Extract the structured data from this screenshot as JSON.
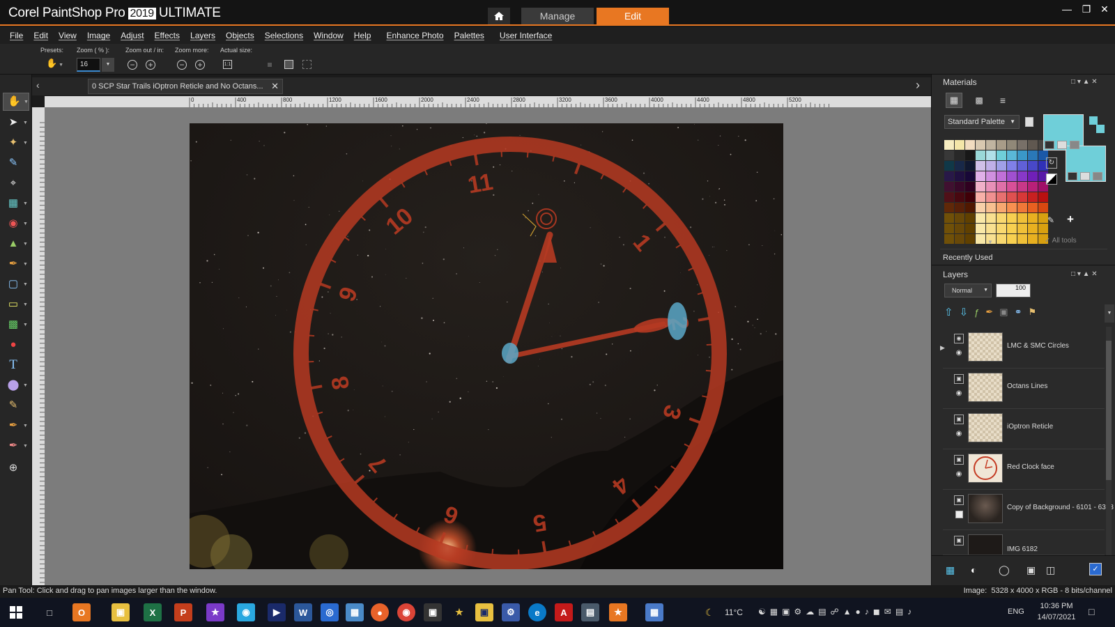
{
  "window": {
    "app_name": "Corel PaintShop Pro",
    "app_year": "2019",
    "app_edition": "ULTIMATE",
    "tabs": {
      "manage": "Manage",
      "edit": "Edit"
    }
  },
  "menu": [
    "File",
    "Edit",
    "View",
    "Image",
    "Adjust",
    "Effects",
    "Layers",
    "Objects",
    "Selections",
    "Window",
    "Help",
    "Enhance Photo",
    "Palettes",
    "User Interface"
  ],
  "tool_options": {
    "presets_label": "Presets:",
    "zoom_label": "Zoom ( % ):",
    "zoom_value": "16",
    "zoom_out_in_label": "Zoom out / in:",
    "zoom_more_label": "Zoom more:",
    "actual_size_label": "Actual size:"
  },
  "document": {
    "tab_title": "0 SCP Star Trails iOptron Reticle and No Octans...",
    "ruler_top_labels": [
      "0",
      "400",
      "800",
      "1200",
      "1600",
      "2000",
      "2400",
      "2800",
      "3200",
      "3600",
      "4000",
      "4400",
      "4800",
      "5200"
    ],
    "clock_numbers": [
      "1",
      "2",
      "3",
      "4",
      "5",
      "6",
      "7",
      "8",
      "9",
      "10",
      "11"
    ]
  },
  "materials": {
    "title": "Materials",
    "palette_select": "Standard Palette",
    "all_tools_label": "All tools",
    "recently_used_label": "Recently Used",
    "foreground_color": "#6fcfd9",
    "background_color": "#6fcfd9"
  },
  "layers": {
    "title": "Layers",
    "blend_mode": "Normal",
    "opacity": "100",
    "items": [
      {
        "name": "LMC & SMC Circles"
      },
      {
        "name": "Octans Lines"
      },
      {
        "name": "iOptron Reticle"
      },
      {
        "name": "Red Clock face"
      },
      {
        "name": "Copy of Background - 6101 - 6323"
      },
      {
        "name": "IMG 6182"
      }
    ]
  },
  "status": {
    "hint": "Pan Tool: Click and drag to pan images larger than the window.",
    "image_info": "Image:  5328 x 4000 x RGB - 8 bits/channel"
  },
  "taskbar": {
    "temperature": "11°C",
    "language": "ENG",
    "time": "10:36 PM",
    "date": "14/07/2021"
  },
  "colors": {
    "accent": "#e87722",
    "clock_red": "#b63a22",
    "selection_blue": "#3a8ad0"
  }
}
